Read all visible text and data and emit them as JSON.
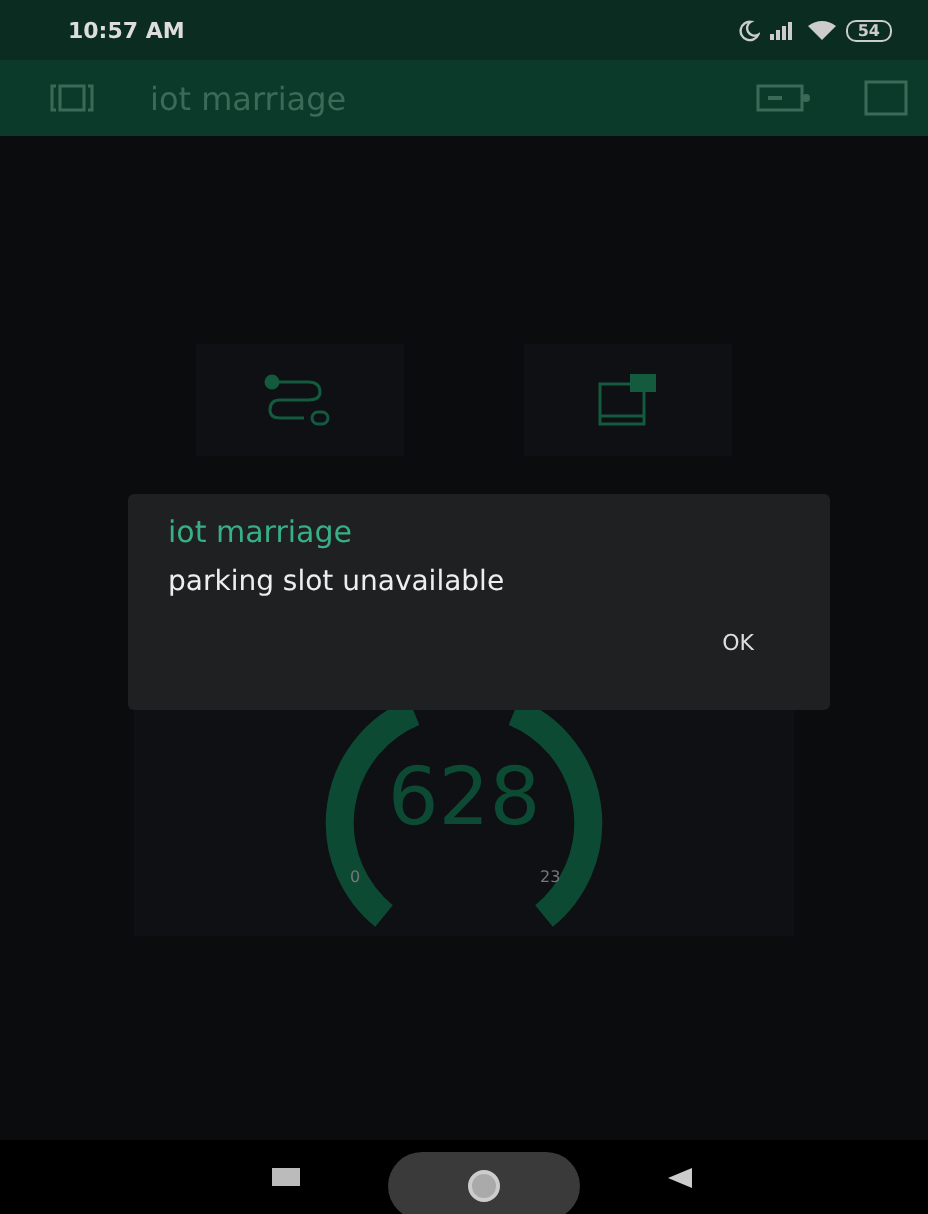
{
  "status_bar": {
    "time": "10:57 AM",
    "battery": "54"
  },
  "app_bar": {
    "title": "iot marriage"
  },
  "widgets": [
    {
      "kind": "route"
    },
    {
      "kind": "notify"
    }
  ],
  "gauge": {
    "value": "628",
    "min": "0",
    "max": "23"
  },
  "dialog": {
    "title": "iot marriage",
    "message": "parking slot unavailable",
    "button": "OK"
  }
}
